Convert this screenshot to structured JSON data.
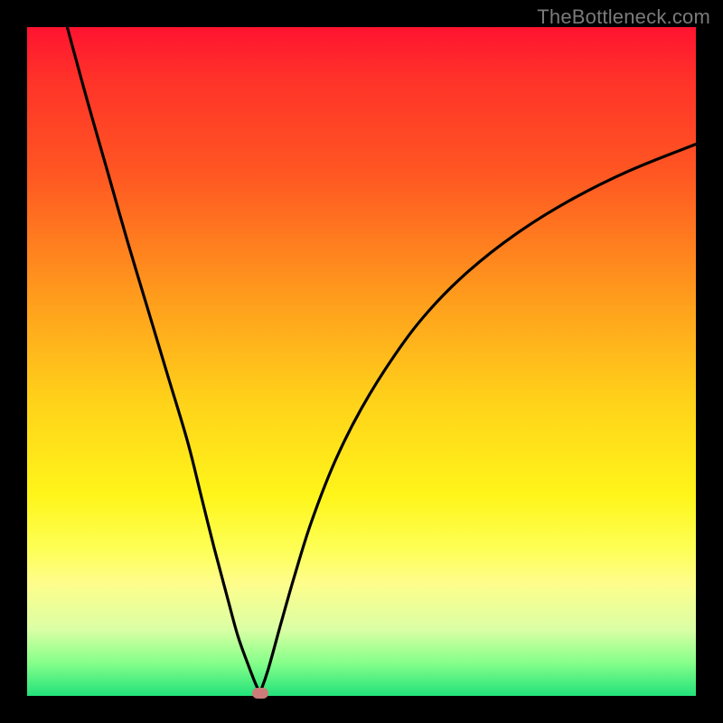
{
  "attribution": "TheBottleneck.com",
  "chart_data": {
    "type": "line",
    "title": "",
    "xlabel": "",
    "ylabel": "",
    "xlim": [
      0,
      100
    ],
    "ylim": [
      0,
      100
    ],
    "series": [
      {
        "name": "left-branch",
        "x": [
          6,
          9,
          12,
          15,
          18,
          21,
          24,
          26,
          28,
          30,
          31.5,
          33,
          34,
          34.8
        ],
        "values": [
          100,
          89,
          78.5,
          68,
          58,
          48,
          38,
          30,
          22,
          14.5,
          9,
          4.8,
          2.2,
          0.4
        ]
      },
      {
        "name": "right-branch",
        "x": [
          34.8,
          36,
          38,
          40,
          42.5,
          46,
          50,
          55,
          60,
          66,
          73,
          81,
          90,
          100
        ],
        "values": [
          0.4,
          3.8,
          11,
          18,
          26,
          35,
          43,
          51,
          57.5,
          63.5,
          69,
          74,
          78.5,
          82.5
        ]
      }
    ],
    "annotations": [
      {
        "name": "min-marker",
        "x": 34.8,
        "y": 0.4
      }
    ],
    "background_gradient": {
      "top": "#ff1330",
      "mid": "#ffd21a",
      "bottom": "#22e27a"
    }
  }
}
